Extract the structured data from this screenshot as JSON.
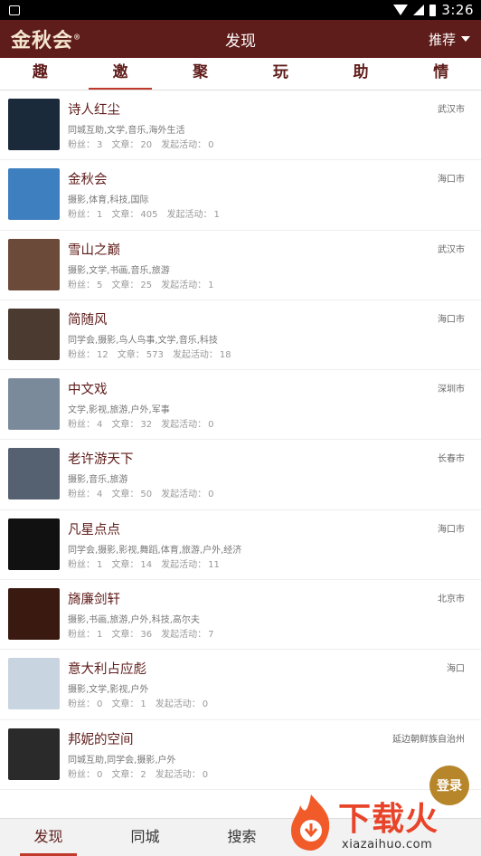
{
  "status": {
    "time": "3:26"
  },
  "header": {
    "logo": "金秋会",
    "title": "发现",
    "recommend": "推荐"
  },
  "tabs": [
    "趣",
    "邀",
    "聚",
    "玩",
    "助",
    "情"
  ],
  "active_tab": 1,
  "stat_labels": {
    "fans": "粉丝：",
    "articles": "文章：",
    "activities": "发起活动："
  },
  "users": [
    {
      "name": "诗人红尘",
      "tags": "同城互助,文学,音乐,海外生活",
      "fans": "3",
      "articles": "20",
      "activities": "0",
      "city": "武汉市",
      "avatar_color": "#1b2a3a"
    },
    {
      "name": "金秋会",
      "tags": "摄影,体育,科技,国际",
      "fans": "1",
      "articles": "405",
      "activities": "1",
      "city": "海口市",
      "avatar_color": "#3d7fbf"
    },
    {
      "name": "雪山之巅",
      "tags": "摄影,文学,书画,音乐,旅游",
      "fans": "5",
      "articles": "25",
      "activities": "1",
      "city": "武汉市",
      "avatar_color": "#6b4a3a"
    },
    {
      "name": "简随风",
      "tags": "同学会,摄影,鸟人鸟事,文学,音乐,科技",
      "fans": "12",
      "articles": "573",
      "activities": "18",
      "city": "海口市",
      "avatar_color": "#4a3a30"
    },
    {
      "name": "中文戏",
      "tags": "文学,影视,旅游,户外,军事",
      "fans": "4",
      "articles": "32",
      "activities": "0",
      "city": "深圳市",
      "avatar_color": "#7a8a9a"
    },
    {
      "name": "老许游天下",
      "tags": "摄影,音乐,旅游",
      "fans": "4",
      "articles": "50",
      "activities": "0",
      "city": "长春市",
      "avatar_color": "#556070"
    },
    {
      "name": "凡星点点",
      "tags": "同学会,摄影,影视,舞蹈,体育,旅游,户外,经济",
      "fans": "1",
      "articles": "14",
      "activities": "11",
      "city": "海口市",
      "avatar_color": "#111111"
    },
    {
      "name": "旖廉剑轩",
      "tags": "摄影,书画,旅游,户外,科技,高尔夫",
      "fans": "1",
      "articles": "36",
      "activities": "7",
      "city": "北京市",
      "avatar_color": "#3a1a10"
    },
    {
      "name": "意大利占应彪",
      "tags": "摄影,文学,影视,户外",
      "fans": "0",
      "articles": "1",
      "activities": "0",
      "city": "海口",
      "avatar_color": "#c8d4e0"
    },
    {
      "name": "邦妮的空间",
      "tags": "同城互助,同学会,摄影,户外",
      "fans": "0",
      "articles": "2",
      "activities": "0",
      "city": "延边朝鲜族自治州",
      "avatar_color": "#2a2a2a"
    }
  ],
  "bottom_nav": [
    "发现",
    "同城",
    "搜索"
  ],
  "login_label": "登录",
  "watermark": {
    "text": "下载火",
    "url": "xiazaihuo.com"
  },
  "colors": {
    "brand": "#5e1c1a",
    "accent": "#c0392b",
    "login": "#b7862a"
  }
}
